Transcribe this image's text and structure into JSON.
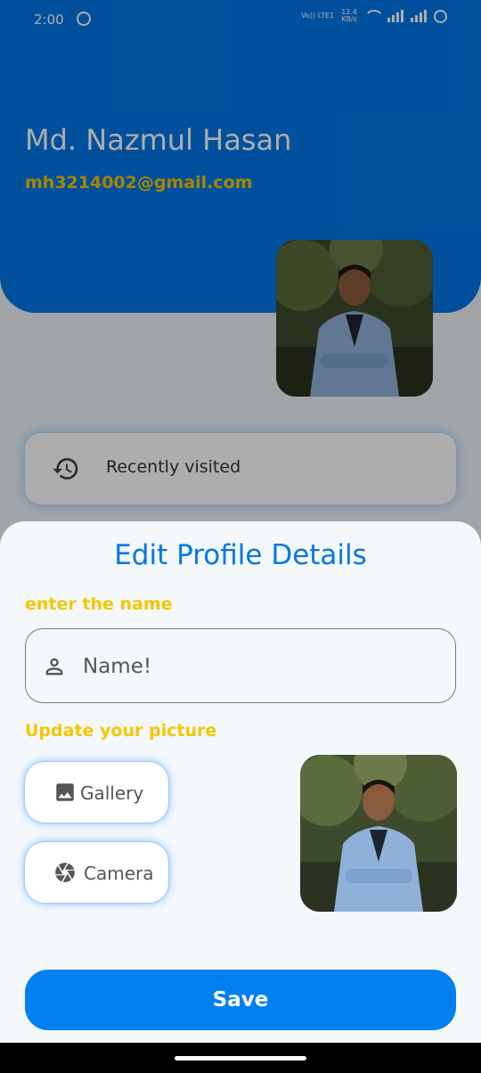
{
  "status_bar": {
    "time": "2:00",
    "network_label": "Vo)) LTE1",
    "speed_value": "12.4",
    "speed_unit": "KB/s"
  },
  "header": {
    "user_name": "Md. Nazmul Hasan",
    "user_email": "mh3214002@gmail.com",
    "avatar_icon": "profile-photo"
  },
  "recent": {
    "label": "Recently visited",
    "icon": "history-icon"
  },
  "sheet": {
    "title": "Edit Profile Details",
    "name_label": "enter the name",
    "name_placeholder": "Name!",
    "name_value": "",
    "picture_label": "Update your picture",
    "gallery_label": "Gallery",
    "camera_label": "Camera",
    "save_label": "Save"
  },
  "colors": {
    "primary": "#0277e8",
    "accent_yellow": "#f6c600",
    "sheet_bg": "#f4f8fb"
  }
}
